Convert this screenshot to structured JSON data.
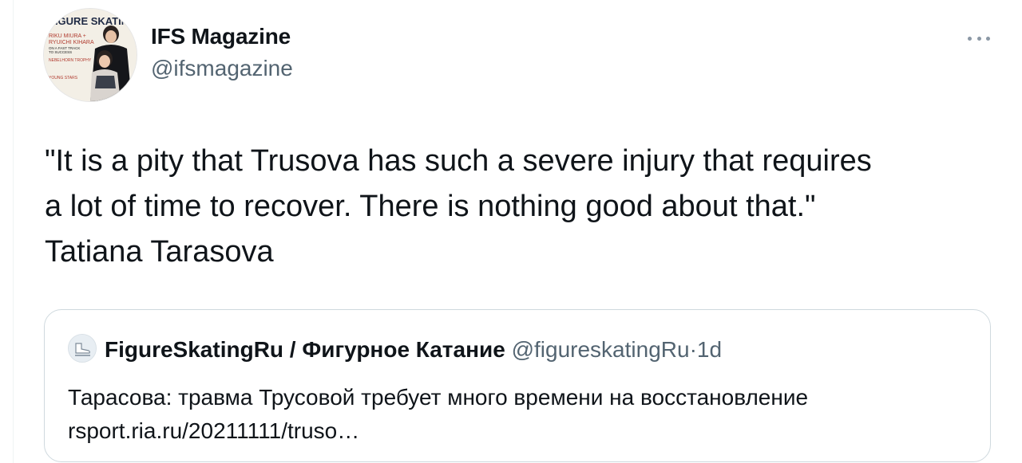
{
  "tweet": {
    "author_name": "IFS Magazine",
    "author_handle": "@ifsmagazine",
    "avatar_cover": {
      "masthead": "FIGURE SKATING",
      "line1": "RIKU MIURA +",
      "line2": "RYUICHI KIHARA",
      "line3": "ON A FAST TRACK",
      "line4": "TO SUCCESS",
      "line5": "NEBELHORN TROPHY",
      "line6": "YOUNG STARS"
    },
    "text": "\"It is a pity that Trusova has such a severe injury that requires\na lot of time to recover. There is nothing good about that.\"\nTatiana Tarasova",
    "more_icon": "more-horizontal-icon"
  },
  "quoted": {
    "author_name": "FigureSkatingRu / Фигурное Катание",
    "author_handle": "@figureskatingRu",
    "separator": "·",
    "time": "1d",
    "body_line1": "Тарасова: травма Трусовой требует много времени на восстановление",
    "body_line2": "rsport.ria.ru/20211111/truso…"
  },
  "colors": {
    "text": "#0f1419",
    "secondary": "#536471",
    "border": "#cfd9de"
  }
}
